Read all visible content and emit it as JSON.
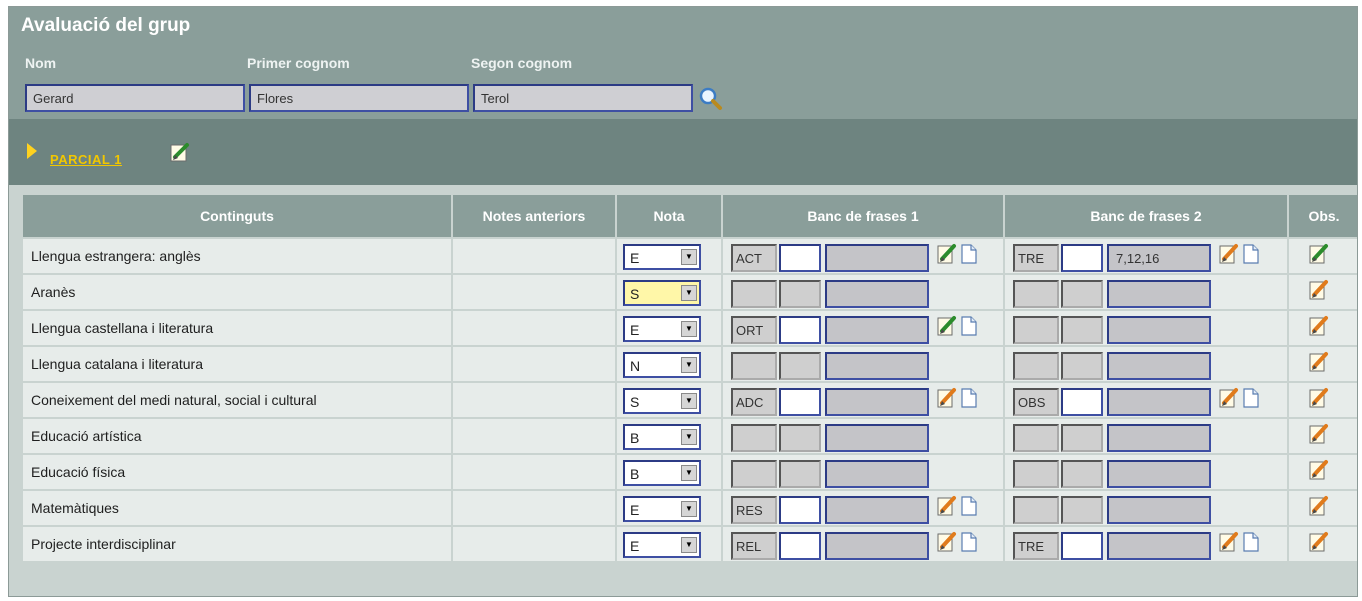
{
  "header": {
    "title": "Avaluació del grup",
    "fields": [
      {
        "label": "Nom",
        "value": "Gerard"
      },
      {
        "label": "Primer cognom",
        "value": "Flores"
      },
      {
        "label": "Segon cognom",
        "value": "Terol"
      }
    ]
  },
  "section": {
    "link": "PARCIAL 1"
  },
  "table": {
    "columns": [
      "Continguts",
      "Notes anteriors",
      "Nota",
      "Banc de frases 1",
      "Banc de frases 2",
      "Obs."
    ],
    "rows": [
      {
        "name": "Llengua estrangera: anglès",
        "nota": "E",
        "b1": {
          "code": "ACT",
          "num": "",
          "text": "",
          "icons": true,
          "edit_icon": "edit-green-icon"
        },
        "b2": {
          "code": "TRE",
          "num": "",
          "text": "7,12,16",
          "icons": true
        },
        "obs_icon": "edit-green-icon"
      },
      {
        "name": "Aranès",
        "nota": "S",
        "nota_highlight": true,
        "b1": {
          "code": "",
          "num": "",
          "text": "",
          "icons": false
        },
        "b2": {
          "code": "",
          "num": "",
          "text": "",
          "icons": false
        },
        "obs_icon": "edit-orange-icon"
      },
      {
        "name": "Llengua castellana i literatura",
        "nota": "E",
        "b1": {
          "code": "ORT",
          "num": "",
          "text": "",
          "icons": true,
          "edit_icon": "edit-green-icon"
        },
        "b2": {
          "code": "",
          "num": "",
          "text": "",
          "icons": false
        },
        "obs_icon": "edit-orange-icon"
      },
      {
        "name": "Llengua catalana i literatura",
        "nota": "N",
        "b1": {
          "code": "",
          "num": "",
          "text": "",
          "icons": false
        },
        "b2": {
          "code": "",
          "num": "",
          "text": "",
          "icons": false
        },
        "obs_icon": "edit-orange-icon"
      },
      {
        "name": "Coneixement del medi natural, social i cultural",
        "nota": "S",
        "b1": {
          "code": "ADC",
          "num": "",
          "text": "",
          "icons": true
        },
        "b2": {
          "code": "OBS",
          "num": "",
          "text": "",
          "icons": true
        },
        "obs_icon": "edit-orange-icon"
      },
      {
        "name": "Educació artística",
        "nota": "B",
        "b1": {
          "code": "",
          "num": "",
          "text": "",
          "icons": false
        },
        "b2": {
          "code": "",
          "num": "",
          "text": "",
          "icons": false
        },
        "obs_icon": "edit-orange-icon"
      },
      {
        "name": "Educació física",
        "nota": "B",
        "b1": {
          "code": "",
          "num": "",
          "text": "",
          "icons": false
        },
        "b2": {
          "code": "",
          "num": "",
          "text": "",
          "icons": false
        },
        "obs_icon": "edit-orange-icon"
      },
      {
        "name": "Matemàtiques",
        "nota": "E",
        "b1": {
          "code": "RES",
          "num": "",
          "text": "",
          "icons": true
        },
        "b2": {
          "code": "",
          "num": "",
          "text": "",
          "icons": false
        },
        "obs_icon": "edit-orange-icon"
      },
      {
        "name": "Projecte interdisciplinar",
        "nota": "E",
        "b1": {
          "code": "REL",
          "num": "",
          "text": "",
          "icons": true
        },
        "b2": {
          "code": "TRE",
          "num": "",
          "text": "",
          "icons": true
        },
        "obs_icon": "edit-orange-icon"
      }
    ]
  }
}
